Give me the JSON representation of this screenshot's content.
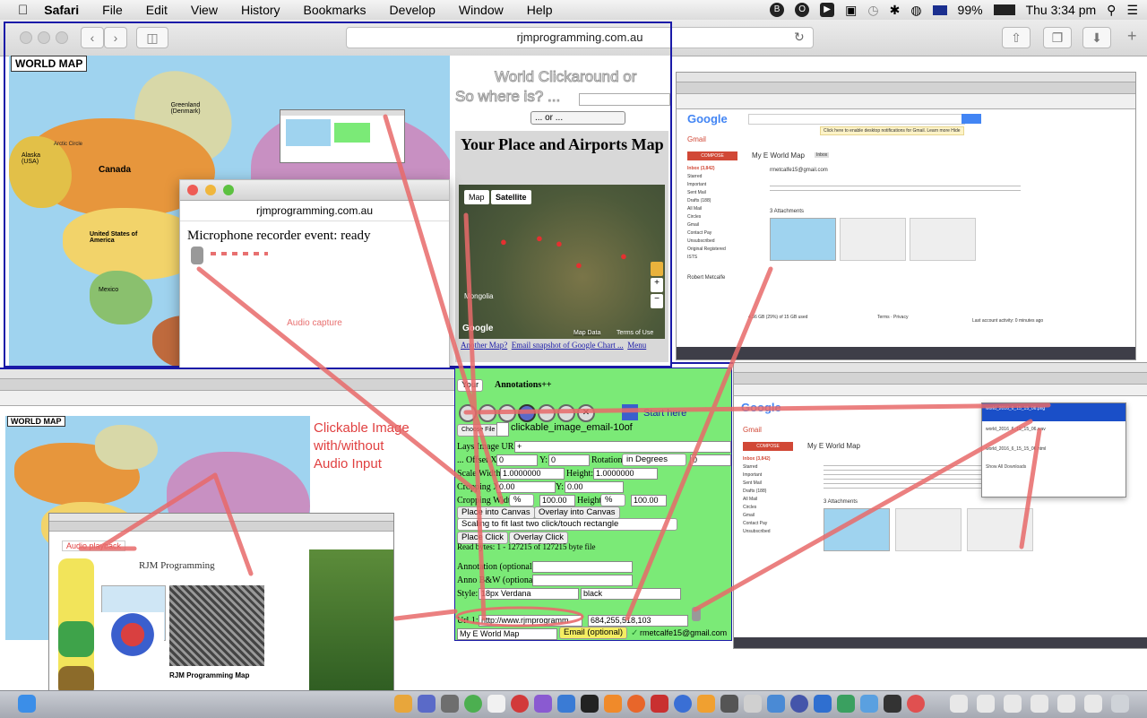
{
  "menubar": {
    "app": "Safari",
    "items": [
      "File",
      "Edit",
      "View",
      "History",
      "Bookmarks",
      "Develop",
      "Window",
      "Help"
    ],
    "battery": "99%",
    "clock": "Thu 3:34 pm"
  },
  "safari": {
    "url": "rjmprogramming.com.au"
  },
  "world_map": {
    "title": "WORLD MAP",
    "labels": [
      "Greenland (Denmark)",
      "Arctic Circle",
      "Alaska (USA)",
      "Canada",
      "United States of America",
      "Mexico"
    ]
  },
  "clickaround": {
    "title_line1": "World Clickaround or",
    "title_line2": "So where is? ...",
    "select_value": "... or ..."
  },
  "airports": {
    "heading": "Your Place and Airports Map",
    "map_button": "Map",
    "satellite_button": "Satellite",
    "country_label": "Mongolia",
    "google_logo": "Google",
    "map_data": "Map Data",
    "terms": "Terms of Use",
    "link_another": "Another Map?",
    "link_email": "Email snapshot of Google Chart ...",
    "link_menu": "Menu"
  },
  "mic_window": {
    "url": "rjmprogramming.com.au",
    "status": "Microphone recorder event: ready",
    "audio_caption": "Audio capture"
  },
  "gmail_top": {
    "logo": "Google",
    "gmail_label": "Gmail",
    "compose": "COMPOSE",
    "subject": "My E World Map",
    "inbox_tag": "Inbox",
    "sender": "rmetcalfe15@gmail.com",
    "notice": "Click here to enable desktop notifications for Gmail.   Learn more  Hide",
    "attachments": "3 Attachments",
    "sidebar": [
      "Inbox (3,842)",
      "Starred",
      "Important",
      "Sent Mail",
      "Drafts (188)",
      "All Mail",
      "Circles",
      "Gmail",
      "Contact Pay",
      "Unsubscribed",
      "Original Registered",
      "ISTS"
    ],
    "contact_name": "Robert Metcalfe",
    "footer_left": "4.36 GB (29%) of 15 GB used",
    "footer_mid": "Terms · Privacy",
    "footer_right": "Last account activity: 0 minutes ago"
  },
  "clickable_caption": {
    "line1": "Clickable Image",
    "line2": "with/without",
    "line3": "Audio Input"
  },
  "audio_playback": "Audio playback",
  "rjm": {
    "title": "RJM Programming",
    "map_title": "RJM Programming Map"
  },
  "form": {
    "your_select": "Your",
    "annotations": "Annotations++",
    "start_here": "Start here",
    "choose_file": "Choose File",
    "filename": "clickable_image_email-10of",
    "image_url_label": "Lays Image URL:",
    "image_url_value": "+",
    "offset_x_label": "... Offset X:",
    "offset_x": "0",
    "offset_y_label": "Y:",
    "offset_y": "0",
    "rotation_label": "Rotation",
    "rotation_unit": "in Degrees",
    "rotation_value": "0",
    "scale_width_label": "Scale Width:",
    "scale_width": "1.0000000",
    "height_label": "Height:",
    "height": "1.0000000",
    "crop_x_label": "Cropping X:",
    "crop_x": "0.00",
    "crop_y_label": "Y:",
    "crop_y": "0.00",
    "crop_w_label": "Cropping Width:",
    "crop_w_unit": "%",
    "crop_w": "100.00",
    "crop_h_label": "Height:",
    "crop_h_unit": "%",
    "crop_h": "100.00",
    "place_canvas": "Place into Canvas",
    "overlay_canvas": "Overlay into Canvas",
    "scaling_select": "Scaling to fit last two click/touch rectangle",
    "place_click": "Place Click",
    "overlay_click": "Overlay Click",
    "read_bytes": "Read bytes: 1 - 127215 of 127215 byte file",
    "annotation_label": "Annotation (optional):",
    "anno_bw_label": "Anno B&W (optional):",
    "style_label": "Style:",
    "style_value": "18px Verdana",
    "style_color": "black",
    "url_label": "Url 1:",
    "url_value": "http://www.rjmprogramm",
    "coords": "684,255,518,103",
    "map_name": "My E World Map",
    "email_button": "Email (optional)",
    "email_value": "rmetcalfe15@gmail.com"
  },
  "gmail_bottom": {
    "logo": "Google",
    "gmail_label": "Gmail",
    "compose": "COMPOSE",
    "subject": "My E World Map",
    "download1": "world_2016_6_15_15_06.png",
    "download2": "world_2016_6_15_15_06.wav",
    "download3": "world_2016_6_15_15_06.html",
    "show_all": "Show All Downloads",
    "attachments": "3 Attachments"
  },
  "colors": {
    "annotation_line": "#e86a6a",
    "form_green": "#7bea77",
    "frame_blue": "#1a1aa8",
    "compose_red": "#d14836"
  }
}
